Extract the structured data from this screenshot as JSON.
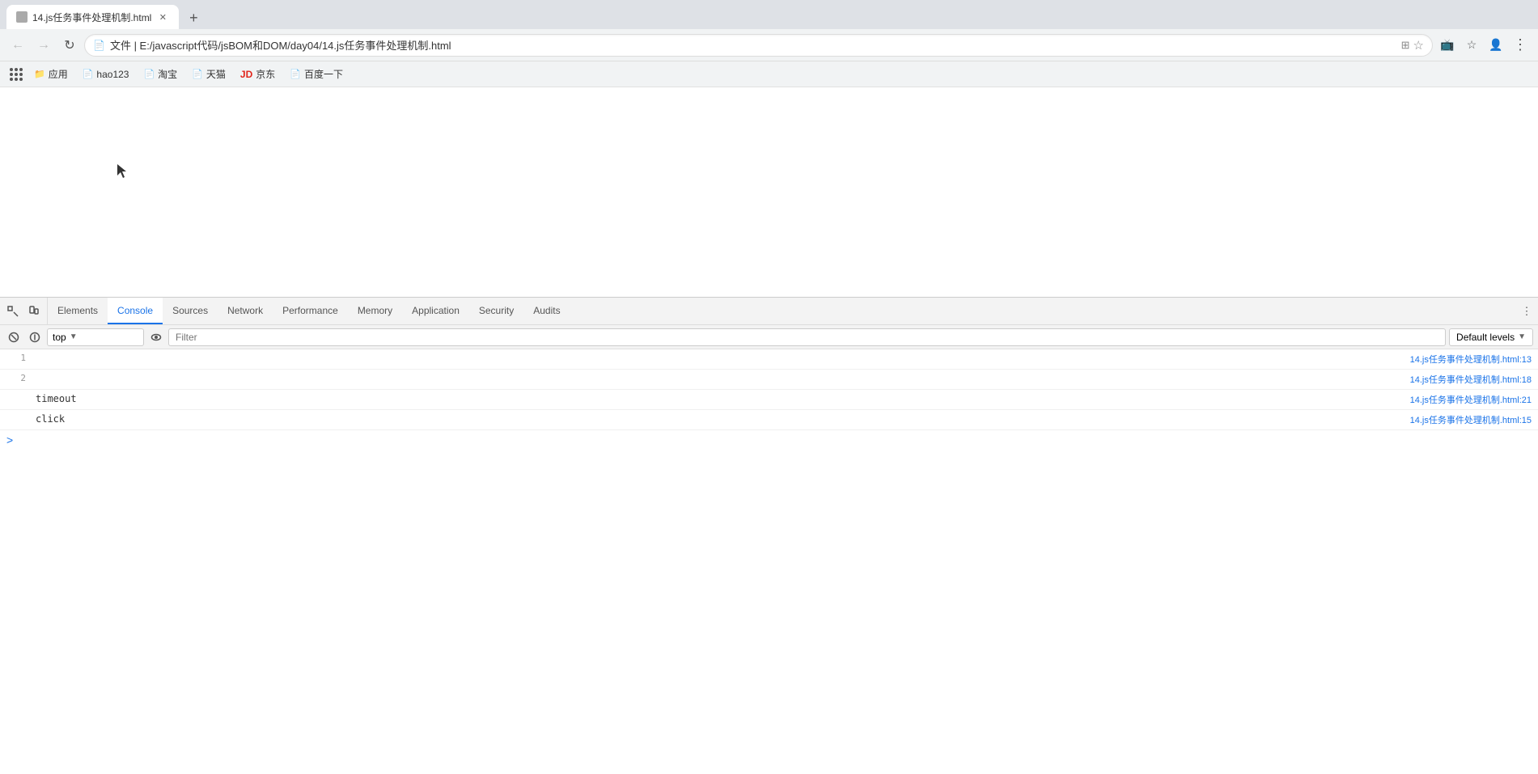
{
  "browser": {
    "tab_title": "14.js任务事件处理机制.html",
    "address": "文件 | E:/javascript代码/jsBOM和DOM/day04/14.js任务事件处理机制.html",
    "address_short": "E:/javascript代码/jsBOM和DOM/day04/14.js任务事件处理机制.html"
  },
  "bookmarks": [
    {
      "id": "apps",
      "label": null,
      "type": "apps"
    },
    {
      "id": "yingyong",
      "label": "应用",
      "type": "folder"
    },
    {
      "id": "hao123",
      "label": "hao123",
      "type": "page"
    },
    {
      "id": "taobao",
      "label": "淘宝",
      "type": "page"
    },
    {
      "id": "tianmao",
      "label": "天猫",
      "type": "page"
    },
    {
      "id": "jd",
      "label": "京东",
      "type": "jd"
    },
    {
      "id": "baidu",
      "label": "百度一下",
      "type": "page"
    }
  ],
  "devtools": {
    "tabs": [
      {
        "id": "elements",
        "label": "Elements"
      },
      {
        "id": "console",
        "label": "Console"
      },
      {
        "id": "sources",
        "label": "Sources"
      },
      {
        "id": "network",
        "label": "Network"
      },
      {
        "id": "performance",
        "label": "Performance"
      },
      {
        "id": "memory",
        "label": "Memory"
      },
      {
        "id": "application",
        "label": "Application"
      },
      {
        "id": "security",
        "label": "Security"
      },
      {
        "id": "audits",
        "label": "Audits"
      }
    ],
    "active_tab": "console",
    "context": "top",
    "filter_placeholder": "Filter",
    "levels": "Default levels"
  },
  "console": {
    "lines": [
      {
        "num": "1",
        "text": "",
        "source": "14.js任务事件处理机制.html:13"
      },
      {
        "num": "2",
        "text": "",
        "source": "14.js任务事件处理机制.html:18"
      },
      {
        "num": null,
        "text": "timeout",
        "source": "14.js任务事件处理机制.html:21"
      },
      {
        "num": null,
        "text": "click",
        "source": "14.js任务事件处理机制.html:15"
      }
    ],
    "prompt": ">"
  }
}
